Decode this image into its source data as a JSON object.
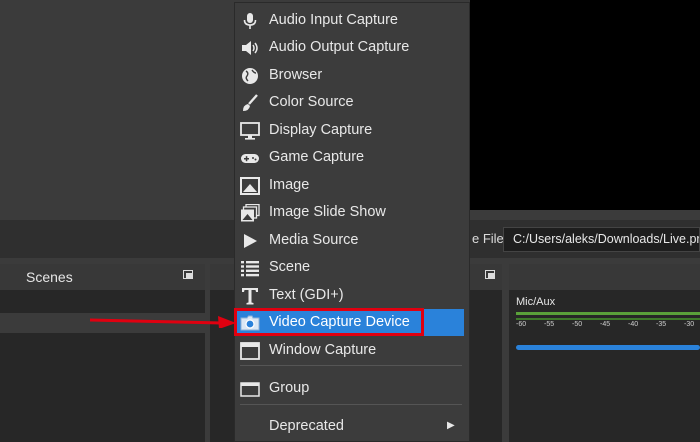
{
  "preview_bar": {
    "file_label": "e File",
    "file_path": "C:/Users/aleks/Downloads/Live.pr"
  },
  "docks": {
    "scenes_title": "Scenes"
  },
  "mixer": {
    "channel_label": "Mic/Aux",
    "ticks": [
      "-60",
      "-55",
      "-50",
      "-45",
      "-40",
      "-35",
      "-30"
    ]
  },
  "menu": {
    "items": [
      {
        "label": "Audio Input Capture",
        "icon": "microphone-icon"
      },
      {
        "label": "Audio Output Capture",
        "icon": "speaker-icon"
      },
      {
        "label": "Browser",
        "icon": "globe-icon"
      },
      {
        "label": "Color Source",
        "icon": "brush-icon"
      },
      {
        "label": "Display Capture",
        "icon": "monitor-icon"
      },
      {
        "label": "Game Capture",
        "icon": "gamepad-icon"
      },
      {
        "label": "Image",
        "icon": "image-icon"
      },
      {
        "label": "Image Slide Show",
        "icon": "slideshow-icon"
      },
      {
        "label": "Media Source",
        "icon": "play-icon"
      },
      {
        "label": "Scene",
        "icon": "list-icon"
      },
      {
        "label": "Text (GDI+)",
        "icon": "text-icon"
      },
      {
        "label": "Video Capture Device",
        "icon": "camera-icon",
        "selected": true
      },
      {
        "label": "Window Capture",
        "icon": "window-icon"
      },
      {
        "label": "Group",
        "icon": "folder-icon"
      },
      {
        "label": "Deprecated",
        "icon": "",
        "submenu": true
      }
    ],
    "selected_color": "#2a82da",
    "highlight_color": "#e00010"
  }
}
